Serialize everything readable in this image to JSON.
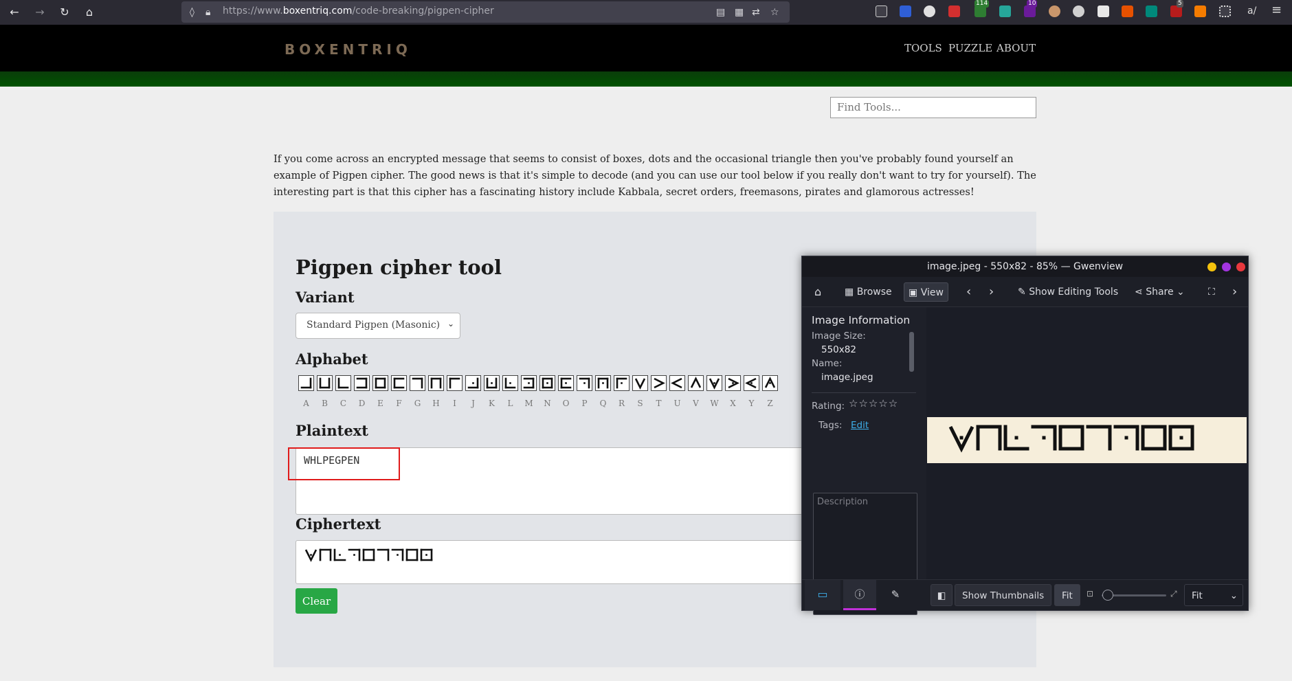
{
  "browser": {
    "url_prefix": "https://www.",
    "url_domain": "boxentriq.com",
    "url_path": "/code-breaking/pigpen-cipher",
    "extension_badges": [
      "114",
      "10",
      "5"
    ]
  },
  "site": {
    "logo": "BOXENTRIQ",
    "nav": [
      "TOOLS",
      "PUZZLE",
      "ABOUT"
    ],
    "search_placeholder": "Find Tools..."
  },
  "intro": "If you come across an encrypted message that seems to consist of boxes, dots and the occasional triangle then you've probably found yourself an example of Pigpen cipher. The good news is that it's simple to decode (and you can use our tool below if you really don't want to try for yourself). The interesting part is that this cipher has a fascinating history include Kabbala, secret orders, freemasons, pirates and glamorous actresses!",
  "tool": {
    "title": "Pigpen cipher tool",
    "variant_label": "Variant",
    "variant_value": "Standard Pigpen (Masonic)",
    "alphabet_label": "Alphabet",
    "letters": [
      "A",
      "B",
      "C",
      "D",
      "E",
      "F",
      "G",
      "H",
      "I",
      "J",
      "K",
      "L",
      "M",
      "N",
      "O",
      "P",
      "Q",
      "R",
      "S",
      "T",
      "U",
      "V",
      "W",
      "X",
      "Y",
      "Z"
    ],
    "plaintext_label": "Plaintext",
    "plaintext_value": "WHLPEGPEN",
    "ciphertext_label": "Ciphertext",
    "clear_label": "Clear"
  },
  "gwenview": {
    "title": "image.jpeg - 550x82 - 85% — Gwenview",
    "browse": "Browse",
    "view": "View",
    "show_editing_tools": "Show Editing Tools",
    "share": "Share",
    "info_header": "Image Information",
    "image_size_label": "Image Size:",
    "image_size_value": "550x82",
    "name_label": "Name:",
    "name_value": "image.jpeg",
    "rating_label": "Rating:",
    "rating_value": 0,
    "rating_max": 5,
    "tags_label": "Tags:",
    "tags_edit": "Edit",
    "description_placeholder": "Description",
    "show_thumbnails": "Show Thumbnails",
    "fit": "Fit",
    "zoom_select": "Fit"
  },
  "colors": {
    "accent_green": "#28a745",
    "highlight_red": "#e01b1b",
    "gwen_link": "#3daee9",
    "gwen_active_tab": "#c030d8"
  }
}
